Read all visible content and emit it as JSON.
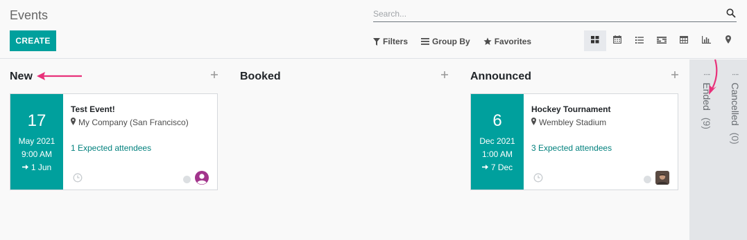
{
  "page": {
    "title": "Events",
    "create_label": "CREATE"
  },
  "search": {
    "placeholder": "Search..."
  },
  "filters": {
    "filters_label": "Filters",
    "group_by_label": "Group By",
    "favorites_label": "Favorites"
  },
  "views": [
    {
      "icon": "kanban-view-icon",
      "active": true
    },
    {
      "icon": "calendar-view-icon",
      "active": false
    },
    {
      "icon": "list-view-icon",
      "active": false
    },
    {
      "icon": "gantt-view-icon",
      "active": false
    },
    {
      "icon": "pivot-view-icon",
      "active": false
    },
    {
      "icon": "graph-view-icon",
      "active": false
    },
    {
      "icon": "map-view-icon",
      "active": false
    }
  ],
  "columns": {
    "new": {
      "title": "New",
      "card": {
        "day": "17",
        "month_year": "May 2021",
        "time": "9:00 AM",
        "end": "1 Jun",
        "name": "Test Event!",
        "location": "My Company (San Francisco)",
        "attendees": "1 Expected attendees"
      }
    },
    "booked": {
      "title": "Booked"
    },
    "announced": {
      "title": "Announced",
      "card": {
        "day": "6",
        "month_year": "Dec 2021",
        "time": "1:00 AM",
        "end": "7 Dec",
        "name": "Hockey Tournament",
        "location": "Wembley Stadium",
        "attendees": "3 Expected attendees"
      }
    }
  },
  "folded_columns": [
    {
      "label": "Ended",
      "count": "(9)"
    },
    {
      "label": "Cancelled",
      "count": "(0)"
    }
  ],
  "colors": {
    "accent": "#00a09d",
    "link": "#01807d",
    "annotation_arrow": "#e8317a",
    "avatar_purple": "#a2348c"
  }
}
